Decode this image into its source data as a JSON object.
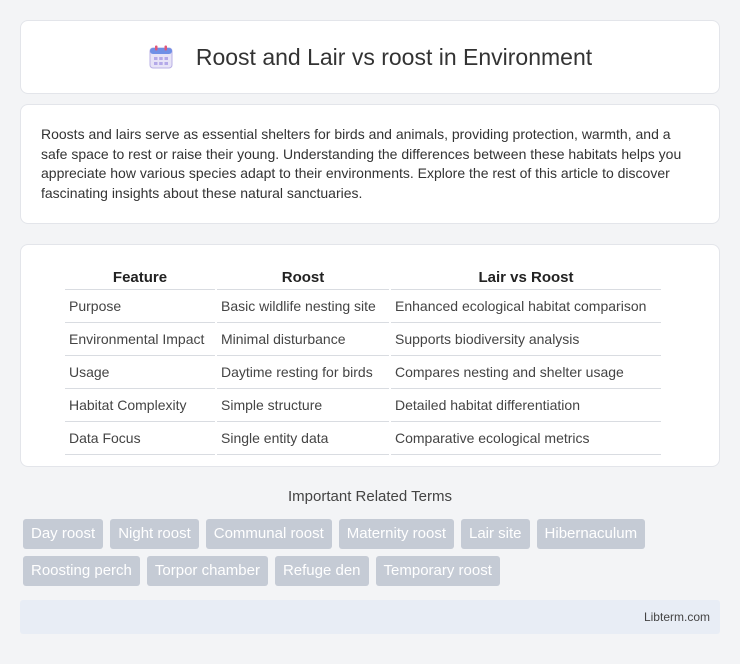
{
  "header": {
    "title": "Roost and Lair vs roost in Environment",
    "icon": "calendar-icon"
  },
  "intro": {
    "text": "Roosts and lairs serve as essential shelters for birds and animals, providing protection, warmth, and a safe space to rest or raise their young. Understanding the differences between these habitats helps you appreciate how various species adapt to their environments. Explore the rest of this article to discover fascinating insights about these natural sanctuaries."
  },
  "table": {
    "headers": [
      "Feature",
      "Roost",
      "Lair vs Roost"
    ],
    "rows": [
      [
        "Purpose",
        "Basic wildlife nesting site",
        "Enhanced ecological habitat comparison"
      ],
      [
        "Environmental Impact",
        "Minimal disturbance",
        "Supports biodiversity analysis"
      ],
      [
        "Usage",
        "Daytime resting for birds",
        "Compares nesting and shelter usage"
      ],
      [
        "Habitat Complexity",
        "Simple structure",
        "Detailed habitat differentiation"
      ],
      [
        "Data Focus",
        "Single entity data",
        "Comparative ecological metrics"
      ]
    ]
  },
  "related": {
    "title": "Important Related Terms",
    "rows": [
      [
        "Day roost",
        "Night roost",
        "Communal roost",
        "Maternity roost",
        "Lair site",
        "Hibernaculum"
      ],
      [
        "Roosting perch",
        "Torpor chamber",
        "Refuge den",
        "Temporary roost"
      ]
    ]
  },
  "footer": {
    "site": "Libterm.com"
  }
}
